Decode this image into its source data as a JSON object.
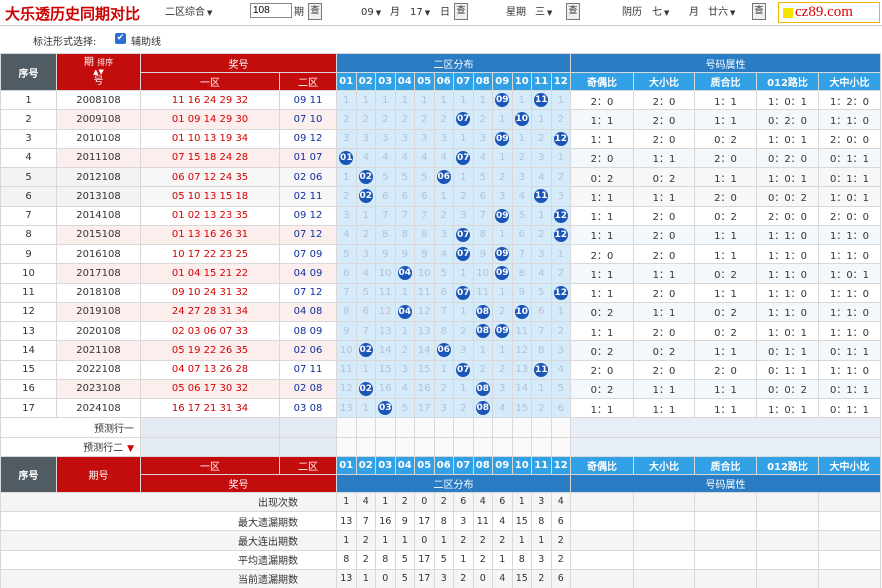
{
  "header": {
    "title": "大乐透历史同期对比",
    "zone_select": "二区综合",
    "period_value": "108",
    "period_unit": "期",
    "query_label": "查",
    "month_value": "09",
    "month_unit": "月",
    "day_value": "17",
    "day_unit": "日",
    "week_label": "星期",
    "week_value": "三",
    "lunar_label": "阴历",
    "lunar_month": "七",
    "lunar_month_unit": "月",
    "lunar_day": "廿六",
    "logo": "cz89.com"
  },
  "options": {
    "label": "标注形式选择:",
    "assist_line": "辅助线",
    "check_mark": "✔"
  },
  "columns": {
    "seq": "序号",
    "period": "期号",
    "period_top": "期",
    "period_bottom": "号",
    "sort": "排序",
    "sort_arrows": "▲▼",
    "prize": "奖号",
    "zone1": "一区",
    "zone2": "二区",
    "dist": "二区分布",
    "attrs_title": "号码属性",
    "attrs": [
      "奇偶比",
      "大小比",
      "质合比",
      "012路比",
      "大中小比"
    ],
    "dist_nums": [
      "01",
      "02",
      "03",
      "04",
      "05",
      "06",
      "07",
      "08",
      "09",
      "10",
      "11",
      "12"
    ]
  },
  "rows": [
    {
      "seq": "1",
      "period": "2008108",
      "front": "11 16 24 29 32",
      "back": "09 11",
      "dist": [
        "1",
        "1",
        "1",
        "1",
        "1",
        "1",
        "1",
        "1",
        "09",
        "1",
        "11",
        "1"
      ],
      "attrs": [
        "2：0",
        "2：0",
        "1：1",
        "1：0：1",
        "1：2：0"
      ]
    },
    {
      "seq": "2",
      "period": "2009108",
      "front": "01 09 14 29 30",
      "back": "07 10",
      "dist": [
        "2",
        "2",
        "2",
        "2",
        "2",
        "2",
        "07",
        "2",
        "1",
        "10",
        "1",
        "2"
      ],
      "attrs": [
        "1：1",
        "2：0",
        "1：1",
        "0：2：0",
        "1：1：0"
      ]
    },
    {
      "seq": "3",
      "period": "2010108",
      "front": "01 10 13 19 34",
      "back": "09 12",
      "dist": [
        "3",
        "3",
        "3",
        "3",
        "3",
        "3",
        "1",
        "3",
        "09",
        "1",
        "2",
        "12"
      ],
      "attrs": [
        "1：1",
        "2：0",
        "0：2",
        "1：0：1",
        "2：0：0"
      ]
    },
    {
      "seq": "4",
      "period": "2011108",
      "front": "07 15 18 24 28",
      "back": "01 07",
      "dist": [
        "01",
        "4",
        "4",
        "4",
        "4",
        "4",
        "07",
        "4",
        "1",
        "2",
        "3",
        "1"
      ],
      "attrs": [
        "2：0",
        "1：1",
        "2：0",
        "0：2：0",
        "0：1：1"
      ]
    },
    {
      "seq": "5",
      "period": "2012108",
      "front": "06 07 12 24 35",
      "back": "02 06",
      "dist": [
        "1",
        "02",
        "5",
        "5",
        "5",
        "06",
        "1",
        "5",
        "2",
        "3",
        "4",
        "2"
      ],
      "attrs": [
        "0：2",
        "0：2",
        "1：1",
        "1：0：1",
        "0：1：1"
      ]
    },
    {
      "seq": "6",
      "period": "2013108",
      "front": "05 10 13 15 18",
      "back": "02 11",
      "dist": [
        "2",
        "02",
        "6",
        "6",
        "6",
        "1",
        "2",
        "6",
        "3",
        "4",
        "11",
        "3"
      ],
      "attrs": [
        "1：1",
        "1：1",
        "2：0",
        "0：0：2",
        "1：0：1"
      ]
    },
    {
      "seq": "7",
      "period": "2014108",
      "front": "01 02 13 23 35",
      "back": "09 12",
      "dist": [
        "3",
        "1",
        "7",
        "7",
        "7",
        "2",
        "3",
        "7",
        "09",
        "5",
        "1",
        "12"
      ],
      "attrs": [
        "1：1",
        "2：0",
        "0：2",
        "2：0：0",
        "2：0：0"
      ]
    },
    {
      "seq": "8",
      "period": "2015108",
      "front": "01 13 16 26 31",
      "back": "07 12",
      "dist": [
        "4",
        "2",
        "8",
        "8",
        "8",
        "3",
        "07",
        "8",
        "1",
        "6",
        "2",
        "12"
      ],
      "attrs": [
        "1：1",
        "2：0",
        "1：1",
        "1：1：0",
        "1：1：0"
      ]
    },
    {
      "seq": "9",
      "period": "2016108",
      "front": "10 17 22 23 25",
      "back": "07 09",
      "dist": [
        "5",
        "3",
        "9",
        "9",
        "9",
        "4",
        "07",
        "9",
        "09",
        "7",
        "3",
        "1"
      ],
      "attrs": [
        "2：0",
        "2：0",
        "1：1",
        "1：1：0",
        "1：1：0"
      ]
    },
    {
      "seq": "10",
      "period": "2017108",
      "front": "01 04 15 21 22",
      "back": "04 09",
      "dist": [
        "6",
        "4",
        "10",
        "04",
        "10",
        "5",
        "1",
        "10",
        "09",
        "8",
        "4",
        "2"
      ],
      "attrs": [
        "1：1",
        "1：1",
        "0：2",
        "1：1：0",
        "1：0：1"
      ]
    },
    {
      "seq": "11",
      "period": "2018108",
      "front": "09 10 24 31 32",
      "back": "07 12",
      "dist": [
        "7",
        "5",
        "11",
        "1",
        "11",
        "6",
        "07",
        "11",
        "1",
        "9",
        "5",
        "12"
      ],
      "attrs": [
        "1：1",
        "2：0",
        "1：1",
        "1：1：0",
        "1：1：0"
      ]
    },
    {
      "seq": "12",
      "period": "2019108",
      "front": "24 27 28 31 34",
      "back": "04 08",
      "dist": [
        "8",
        "6",
        "12",
        "04",
        "12",
        "7",
        "1",
        "08",
        "2",
        "10",
        "6",
        "1"
      ],
      "attrs": [
        "0：2",
        "1：1",
        "0：2",
        "1：1：0",
        "1：1：0"
      ]
    },
    {
      "seq": "13",
      "period": "2020108",
      "front": "02 03 06 07 33",
      "back": "08 09",
      "dist": [
        "9",
        "7",
        "13",
        "1",
        "13",
        "8",
        "2",
        "08",
        "09",
        "11",
        "7",
        "2"
      ],
      "attrs": [
        "1：1",
        "2：0",
        "0：2",
        "1：0：1",
        "1：1：0"
      ]
    },
    {
      "seq": "14",
      "period": "2021108",
      "front": "05 19 22 26 35",
      "back": "02 06",
      "dist": [
        "10",
        "02",
        "14",
        "2",
        "14",
        "06",
        "3",
        "1",
        "1",
        "12",
        "8",
        "3"
      ],
      "attrs": [
        "0：2",
        "0：2",
        "1：1",
        "0：1：1",
        "0：1：1"
      ]
    },
    {
      "seq": "15",
      "period": "2022108",
      "front": "04 07 13 26 28",
      "back": "07 11",
      "dist": [
        "11",
        "1",
        "15",
        "3",
        "15",
        "1",
        "07",
        "2",
        "2",
        "13",
        "11",
        "4"
      ],
      "attrs": [
        "2：0",
        "2：0",
        "2：0",
        "0：1：1",
        "1：1：0"
      ]
    },
    {
      "seq": "16",
      "period": "2023108",
      "front": "05 06 17 30 32",
      "back": "02 08",
      "dist": [
        "12",
        "02",
        "16",
        "4",
        "16",
        "2",
        "1",
        "08",
        "3",
        "14",
        "1",
        "5"
      ],
      "attrs": [
        "0：2",
        "1：1",
        "1：1",
        "0：0：2",
        "0：1：1"
      ]
    },
    {
      "seq": "17",
      "period": "2024108",
      "front": "16 17 21 31 34",
      "back": "03 08",
      "dist": [
        "13",
        "1",
        "03",
        "5",
        "17",
        "3",
        "2",
        "08",
        "4",
        "15",
        "2",
        "6"
      ],
      "attrs": [
        "1：1",
        "1：1",
        "1：1",
        "1：0：1",
        "0：1：1"
      ]
    }
  ],
  "predict": [
    "预测行一",
    "预测行二"
  ],
  "predict_arrow": "▼",
  "stats": [
    {
      "label": "出现次数",
      "values": [
        "1",
        "4",
        "1",
        "2",
        "0",
        "2",
        "6",
        "4",
        "6",
        "1",
        "3",
        "4"
      ]
    },
    {
      "label": "最大遗漏期数",
      "values": [
        "13",
        "7",
        "16",
        "9",
        "17",
        "8",
        "3",
        "11",
        "4",
        "15",
        "8",
        "6"
      ]
    },
    {
      "label": "最大连出期数",
      "values": [
        "1",
        "2",
        "1",
        "1",
        "0",
        "1",
        "2",
        "2",
        "2",
        "1",
        "1",
        "2"
      ]
    },
    {
      "label": "平均遗漏期数",
      "values": [
        "8",
        "2",
        "8",
        "5",
        "17",
        "5",
        "1",
        "2",
        "1",
        "8",
        "3",
        "2"
      ]
    },
    {
      "label": "当前遗漏期数",
      "values": [
        "13",
        "1",
        "0",
        "5",
        "17",
        "3",
        "2",
        "0",
        "4",
        "15",
        "2",
        "6"
      ]
    }
  ]
}
